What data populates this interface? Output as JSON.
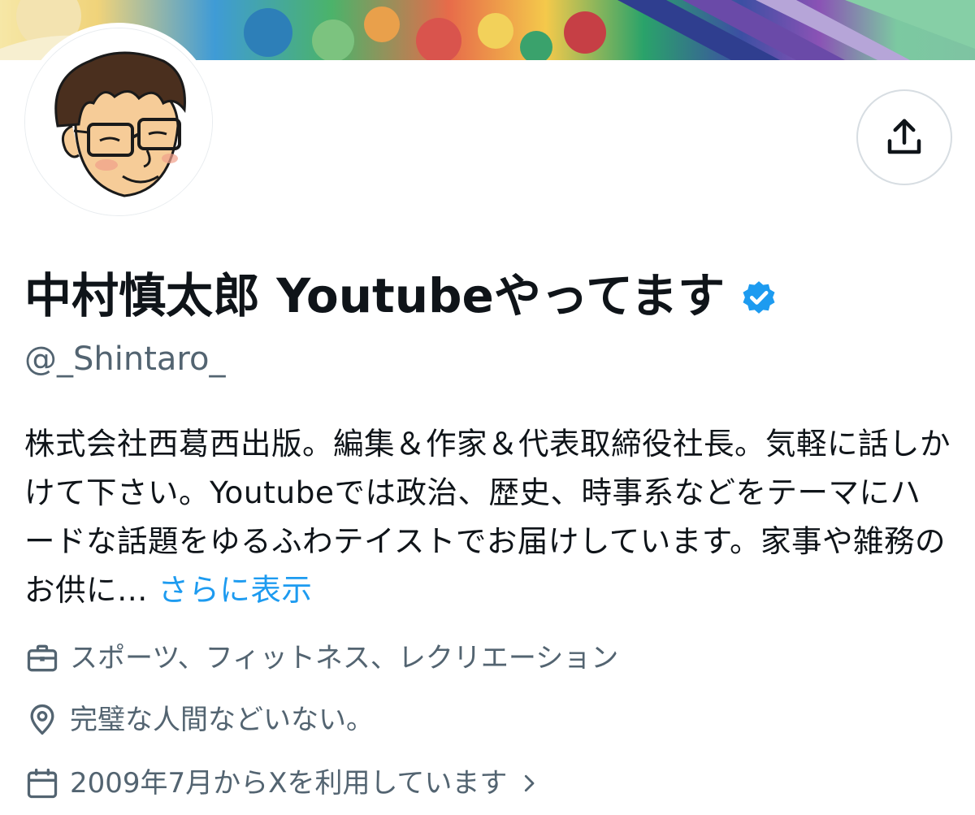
{
  "profile": {
    "display_name": "中村慎太郎 Youtubeやってます",
    "verified_badge": "verified-badge-icon",
    "handle": "@_Shintaro_",
    "bio": {
      "text": "株式会社西葛西出版。編集＆作家＆代表取締役社長。気軽に話しかけて下さい。Youtubeでは政治、歴史、時事系などをテーマにハードな話題をゆるふわテイストでお届けしています。家事や雑務のお供に… ",
      "more_link": "さらに表示"
    },
    "category": "スポーツ、フィットネス、レクリエーション",
    "location": "完璧な人間などいない。",
    "joined": "2009年7月からXを利用しています"
  },
  "icons": {
    "share": "share-icon",
    "category": "briefcase-icon",
    "location": "location-pin-icon",
    "joined": "calendar-icon",
    "joined_chevron": "chevron-right-icon"
  },
  "colors": {
    "text_primary": "#0f1419",
    "text_secondary": "#536471",
    "link": "#1d9bf0",
    "verified": "#1d9bf0"
  }
}
